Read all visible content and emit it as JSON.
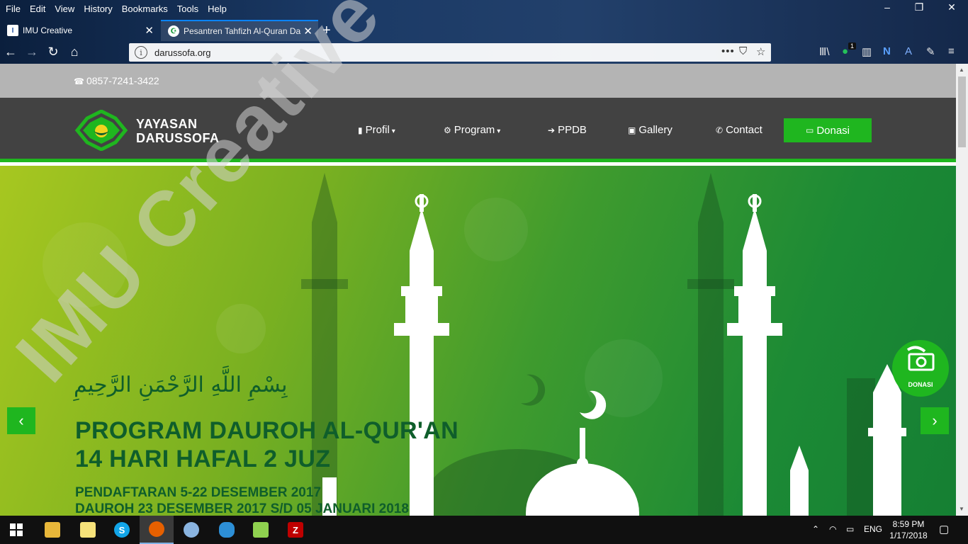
{
  "menubar": {
    "items": [
      "File",
      "Edit",
      "View",
      "History",
      "Bookmarks",
      "Tools",
      "Help"
    ]
  },
  "window_controls": {
    "minimize": "–",
    "restore": "❐",
    "close": "✕"
  },
  "tabs": [
    {
      "title": "IMU Creative",
      "favicon": "I"
    },
    {
      "title": "Pesantren Tahfizh Al-Quran Da",
      "favicon": "☪"
    }
  ],
  "toolbar": {
    "url": "darussofa.org",
    "badge_count": "1"
  },
  "site": {
    "phone": "0857-7241-3422",
    "logo_text": [
      "YAYASAN",
      "DARUSSOFA"
    ],
    "nav": [
      {
        "label": "Profil",
        "icon": "bookmark-icon",
        "dropdown": true
      },
      {
        "label": "Program",
        "icon": "cogs-icon",
        "dropdown": true
      },
      {
        "label": "PPDB",
        "icon": "sign-in-icon",
        "dropdown": false
      },
      {
        "label": "Gallery",
        "icon": "image-icon",
        "dropdown": false
      },
      {
        "label": "Contact",
        "icon": "phone-icon",
        "dropdown": false
      }
    ],
    "donasi_button": "Donasi",
    "accent_color": "#1fb61f",
    "header_color": "#424242"
  },
  "hero": {
    "bismillah": "بِسْمِ اللَّهِ الرَّحْمَنِ الرَّحِيمِ",
    "title_line1": "PROGRAM DAUROH AL-QUR'AN",
    "title_line2": "14 HARI HAFAL 2 JUZ",
    "sub_line1": "PENDAFTARAN 5-22 DESEMBER 2017",
    "sub_line2": "DAUROH 23 DESEMBER 2017 S/D 05 JANUARI 2018",
    "floating_donasi": "DONASI",
    "text_color": "#0f5e2b"
  },
  "watermark": "IMU Creative",
  "taskbar": {
    "language": "ENG",
    "time": "8:59 PM",
    "date": "1/17/2018"
  }
}
